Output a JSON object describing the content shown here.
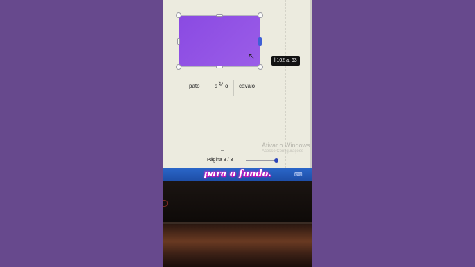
{
  "canvas": {
    "shape_tooltip": "l:102 a: 63",
    "words": [
      "pato",
      "s",
      "o",
      "cavalo"
    ]
  },
  "footer": {
    "page_label": "Página 3 / 3"
  },
  "watermark": {
    "title": "Ativar o Windows",
    "subtitle": "Acesse Configurações"
  },
  "caption": {
    "text": "para o fundo."
  },
  "colors": {
    "background": "#67498d",
    "shape_fill": "#8a4ae2",
    "caption_glow": "#e61fd0",
    "taskbar": "#2a66c8"
  },
  "icons": {
    "rotate": "rotate-icon",
    "cursor": "mouse-pointer-icon",
    "taskbar": "keyboard-icon"
  }
}
